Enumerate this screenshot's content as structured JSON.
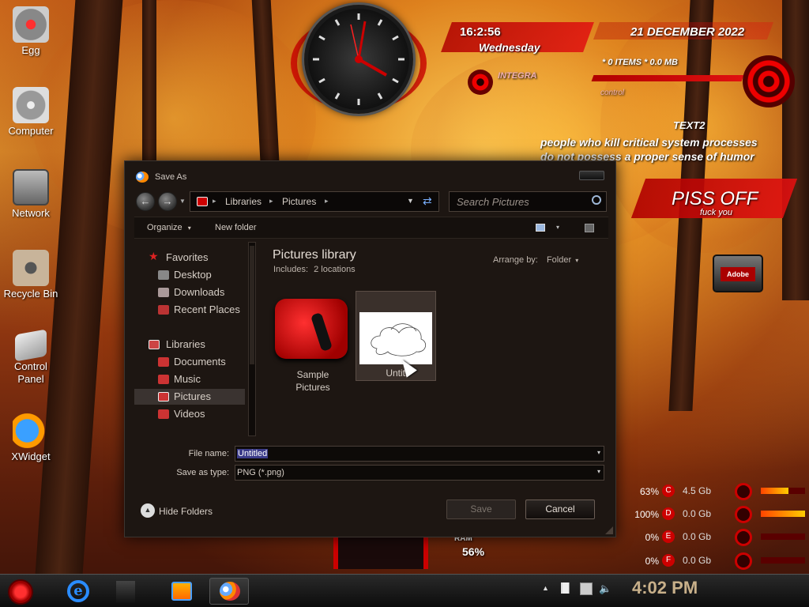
{
  "desktop": {
    "icons": [
      {
        "label": "Egg"
      },
      {
        "label": "Computer"
      },
      {
        "label": "Network"
      },
      {
        "label": "Recycle Bin"
      },
      {
        "label": "Control Panel"
      },
      {
        "label": "XWidget"
      }
    ]
  },
  "widgets": {
    "time": "16:2:56",
    "weekday": "Wednesday",
    "date": "21 DECEMBER 2022",
    "items": "* 0 ITEMS * 0.0 MB",
    "integra": "INTEGRA",
    "control": "control",
    "text2_title": "TEXT2",
    "text2_line1": "people who kill critical system processes",
    "text2_line2": "do not possess a proper sense of humor",
    "piss_off": "PISS OFF",
    "fuck_you": "fuck you",
    "adobe": "Adobe",
    "ram_label": "RAM",
    "ram_value": "56%"
  },
  "drives": [
    {
      "percent": "63%",
      "letter": "C",
      "size": "4.5 Gb",
      "fill": 0.63
    },
    {
      "percent": "100%",
      "letter": "D",
      "size": "0.0 Gb",
      "fill": 1.0
    },
    {
      "percent": "0%",
      "letter": "E",
      "size": "0.0 Gb",
      "fill": 0
    },
    {
      "percent": "0%",
      "letter": "F",
      "size": "0.0 Gb",
      "fill": 0
    }
  ],
  "dialog": {
    "title": "Save As",
    "breadcrumb": [
      "Libraries",
      "Pictures"
    ],
    "search_placeholder": "Search Pictures",
    "toolbar": {
      "organize": "Organize",
      "new_folder": "New folder"
    },
    "nav": {
      "favorites": "Favorites",
      "fav_items": [
        "Desktop",
        "Downloads",
        "Recent Places"
      ],
      "libraries": "Libraries",
      "lib_items": [
        "Documents",
        "Music",
        "Pictures",
        "Videos"
      ]
    },
    "library_title": "Pictures library",
    "includes_label": "Includes:",
    "includes_value": "2 locations",
    "arrange_label": "Arrange by:",
    "arrange_value": "Folder",
    "files": [
      {
        "name_line1": "Sample",
        "name_line2": "Pictures"
      },
      {
        "name_line1": "Untitl",
        "name_line2": ""
      }
    ],
    "file_name_label": "File name:",
    "file_name_value": "Untitled",
    "save_type_label": "Save as type:",
    "save_type_value": "PNG (*.png)",
    "hide_folders": "Hide Folders",
    "save_button": "Save",
    "cancel_button": "Cancel"
  },
  "taskbar": {
    "clock": "4:02 PM"
  },
  "colors": {
    "accent_red": "#c80000",
    "dialog_bg": "#1d1612",
    "selected_nav": "#3a3330"
  }
}
